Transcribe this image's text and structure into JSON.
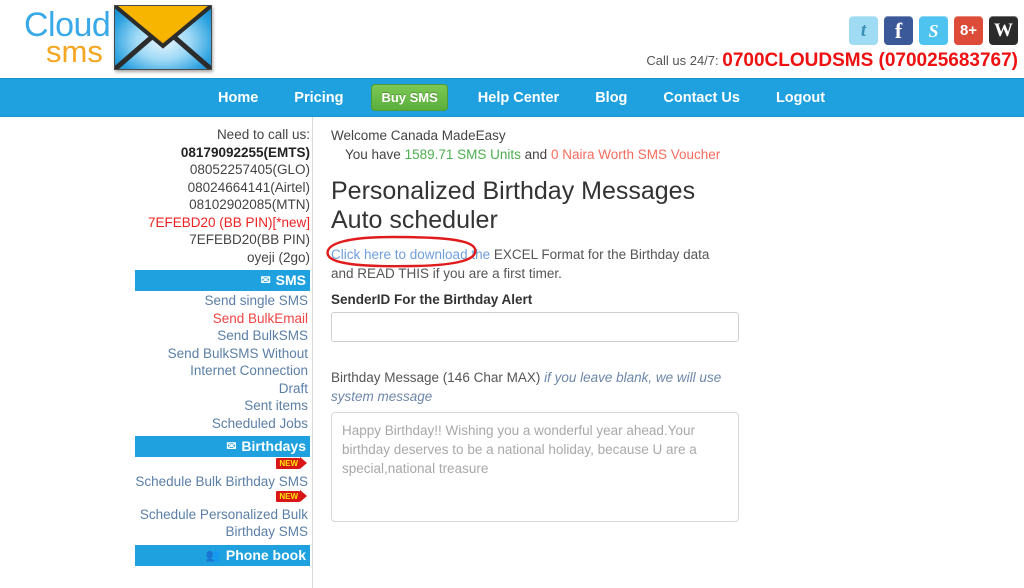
{
  "brand": {
    "name_part1": "Cloud",
    "name_part2": "sms",
    "envelope_icon": "envelope-icon",
    "accent_blue": "#1fa1e0",
    "accent_orange": "#f5a623",
    "accent_green": "#5aaf3c",
    "accent_red": "#ee1111"
  },
  "header": {
    "social": [
      {
        "name": "twitter-icon",
        "glyph": "t"
      },
      {
        "name": "facebook-icon",
        "glyph": "f"
      },
      {
        "name": "skype-icon",
        "glyph": "S"
      },
      {
        "name": "google-plus-icon",
        "glyph": "8+"
      },
      {
        "name": "wordpress-icon",
        "glyph": "W"
      }
    ],
    "call_label": "Call us 24/7:",
    "call_number": "0700CLOUDSMS (070025683767)"
  },
  "nav": {
    "items": [
      {
        "label": "Home",
        "active": false
      },
      {
        "label": "Pricing",
        "active": false
      },
      {
        "label": "Buy SMS",
        "active": true
      },
      {
        "label": "Help Center",
        "active": false
      },
      {
        "label": "Blog",
        "active": false
      },
      {
        "label": "Contact Us",
        "active": false
      },
      {
        "label": "Logout",
        "active": false
      }
    ]
  },
  "sidebar": {
    "need_to_call": "Need to call us:",
    "contacts": [
      {
        "text": "08179092255(EMTS)",
        "style": "bold"
      },
      {
        "text": "08052257405(GLO)",
        "style": "normal"
      },
      {
        "text": "08024664141(Airtel)",
        "style": "normal"
      },
      {
        "text": "08102902085(MTN)",
        "style": "normal"
      },
      {
        "text": "7EFEBD20 (BB PIN)[*new]",
        "style": "red"
      },
      {
        "text": "7EFEBD20(BB PIN)",
        "style": "normal"
      },
      {
        "text": "oyeji (2go)",
        "style": "normal"
      }
    ],
    "sections": [
      {
        "title": "SMS",
        "icon": "envelope-icon",
        "links": [
          {
            "label": "Send single SMS",
            "red": false,
            "badge": false
          },
          {
            "label": "Send BulkEmail",
            "red": true,
            "badge": false
          },
          {
            "label": "Send BulkSMS",
            "red": false,
            "badge": false
          },
          {
            "label": "Send BulkSMS Without Internet Connection",
            "red": false,
            "badge": false
          },
          {
            "label": "Draft",
            "red": false,
            "badge": false
          },
          {
            "label": "Sent items",
            "red": false,
            "badge": false
          },
          {
            "label": "Scheduled Jobs",
            "red": false,
            "badge": false
          }
        ]
      },
      {
        "title": "Birthdays",
        "icon": "envelope-icon",
        "links": [
          {
            "label": "Schedule Bulk Birthday SMS",
            "red": false,
            "badge": true
          },
          {
            "label": "Schedule Personalized Bulk Birthday SMS",
            "red": false,
            "badge": true
          }
        ]
      },
      {
        "title": "Phone book",
        "icon": "contacts-icon",
        "links": []
      }
    ],
    "badge_text": "NEW"
  },
  "main": {
    "welcome": "Welcome Canada MadeEasy",
    "balance_prefix": "You have",
    "balance_units": "1589.71 SMS Units",
    "balance_mid": "and",
    "balance_voucher": "0 Naira Worth SMS Voucher",
    "title": "Personalized Birthday Messages Auto scheduler",
    "download_link": "Click here to download the",
    "download_rest": " EXCEL Format for the Birthday data and READ THIS if you are a first timer.",
    "senderid_label": "SenderID For the Birthday Alert",
    "senderid_value": "",
    "senderid_placeholder": "",
    "message_label": "Birthday Message (146 Char MAX)",
    "message_label_italic": "if you leave blank, we will use system message",
    "message_value": "",
    "message_placeholder": "Happy Birthday!! Wishing you a wonderful year ahead.Your birthday deserves to be a national holiday, because U are a special,national treasure"
  },
  "annotation": {
    "name": "red-ellipse-annotation",
    "color": "#e01b1b"
  }
}
